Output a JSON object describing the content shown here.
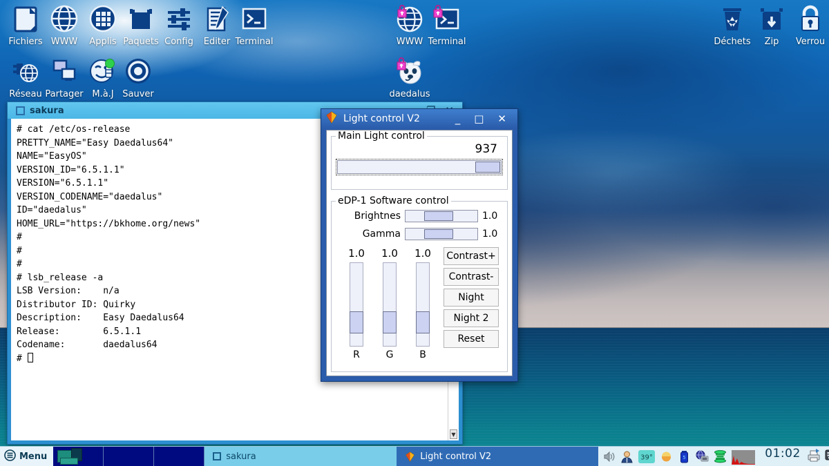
{
  "desktop": {
    "icons_left_row1": [
      {
        "label": "Fichiers",
        "icon": "file-manager-icon"
      },
      {
        "label": "WWW",
        "icon": "globe-icon"
      },
      {
        "label": "Applis",
        "icon": "apps-grid-icon"
      },
      {
        "label": "Paquets",
        "icon": "package-box-icon"
      },
      {
        "label": "Config",
        "icon": "sliders-config-icon"
      },
      {
        "label": "Editer",
        "icon": "text-editor-icon"
      },
      {
        "label": "Terminal",
        "icon": "terminal-icon"
      }
    ],
    "icons_left_row2": [
      {
        "label": "Réseau",
        "icon": "network-plug-icon"
      },
      {
        "label": "Partager",
        "icon": "share-screens-icon"
      },
      {
        "label": "M.à.J",
        "icon": "update-smiley-icon"
      },
      {
        "label": "Sauver",
        "icon": "save-target-icon"
      }
    ],
    "icons_center": [
      {
        "label": "WWW",
        "icon": "globe-locked-icon"
      },
      {
        "label": "Terminal",
        "icon": "terminal-locked-icon"
      },
      {
        "label": "daedalus",
        "icon": "dog-locked-icon"
      }
    ],
    "icons_right": [
      {
        "label": "Déchets",
        "icon": "trash-recycle-icon"
      },
      {
        "label": "Zip",
        "icon": "zip-box-icon"
      },
      {
        "label": "Verrou",
        "icon": "padlock-icon"
      }
    ]
  },
  "sakura": {
    "title": "sakura",
    "minimize_label": "—",
    "maximize_label": "❐",
    "close_label": "✕",
    "content": "# cat /etc/os-release\nPRETTY_NAME=\"Easy Daedalus64\"\nNAME=\"EasyOS\"\nVERSION_ID=\"6.5.1.1\"\nVERSION=\"6.5.1.1\"\nVERSION_CODENAME=\"daedalus\"\nID=\"daedalus\"\nHOME_URL=\"https://bkhome.org/news\"\n#\n#\n#\n# lsb_release -a\nLSB Version:\tn/a\nDistributor ID: Quirky\nDescription:\tEasy Daedalus64\nRelease:\t6.5.1.1\nCodename:\tdaedalus64\n# "
  },
  "light_control": {
    "title": "Light control V2",
    "minimize_label": "_",
    "maximize_label": "□",
    "close_label": "✕",
    "main_group": {
      "legend": "Main Light control",
      "value": "937",
      "slider_percent": 94
    },
    "software_group": {
      "legend": "eDP-1 Software control",
      "brightness": {
        "label": "Brightnes",
        "value": "1.0",
        "percent": 27
      },
      "gamma": {
        "label": "Gamma",
        "value": "1.0",
        "percent": 27
      },
      "channels": [
        {
          "name": "R",
          "value": "1.0",
          "percent": 60
        },
        {
          "name": "G",
          "value": "1.0",
          "percent": 60
        },
        {
          "name": "B",
          "value": "1.0",
          "percent": 60
        }
      ],
      "buttons": [
        "Contrast+",
        "Contrast-",
        "Night",
        "Night 2",
        "Reset"
      ]
    }
  },
  "taskbar": {
    "menu_label": "Menu",
    "tasks": [
      {
        "label": "sakura",
        "active": false
      },
      {
        "label": "Light control V2",
        "active": true
      }
    ],
    "tray_icons": [
      "volume-icon",
      "user-icon",
      "temperature-badge",
      "weather-sun-icon",
      "battery-icon",
      "network-globe-icon",
      "disk-stack-icon",
      "cpu-graph-icon"
    ],
    "temperature": "39°",
    "clock": "01:02",
    "right_icons": [
      "printer-icon",
      "keyboard-icon"
    ]
  },
  "colors": {
    "accent": "#2a5cab",
    "titlebar_sakura": "#63c7ef",
    "taskbar_bg": "#dff0f7",
    "desktop_blue": "#0a5fa8"
  }
}
